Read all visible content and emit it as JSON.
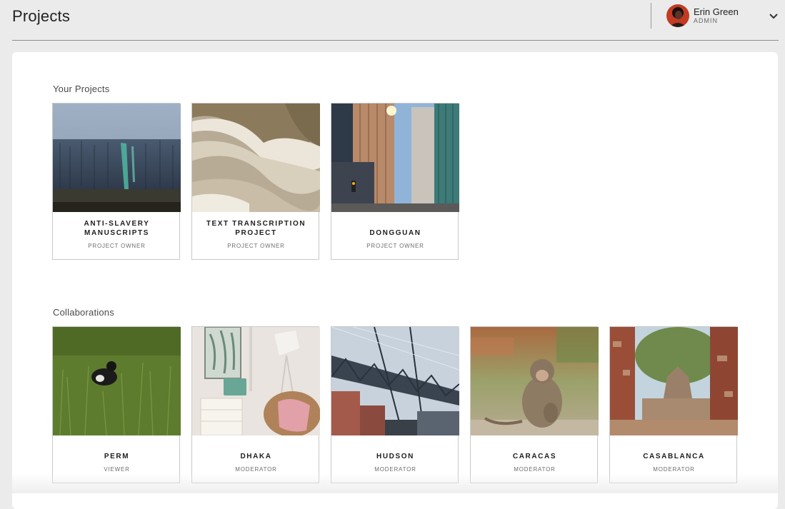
{
  "header": {
    "title": "Projects",
    "user": {
      "name": "Erin Green",
      "role": "ADMIN"
    }
  },
  "sections": {
    "your_projects": {
      "title": "Your Projects",
      "cards": [
        {
          "name": "ANTI-SLAVERY MANUSCRIPTS",
          "role": "PROJECT OWNER",
          "image": "weathered-wall-photo"
        },
        {
          "name": "TEXT TRANSCRIPTION PROJECT",
          "role": "PROJECT OWNER",
          "image": "desert-dunes-photo"
        },
        {
          "name": "DONGGUAN",
          "role": "PROJECT OWNER",
          "image": "city-skyscrapers-photo"
        }
      ]
    },
    "collaborations": {
      "title": "Collaborations",
      "cards": [
        {
          "name": "PERM",
          "role": "VIEWER",
          "image": "bird-in-grass-photo"
        },
        {
          "name": "DHAKA",
          "role": "MODERATOR",
          "image": "vintage-room-photo"
        },
        {
          "name": "HUDSON",
          "role": "MODERATOR",
          "image": "bridge-photo"
        },
        {
          "name": "CARACAS",
          "role": "MODERATOR",
          "image": "monkey-photo"
        },
        {
          "name": "CASABLANCA",
          "role": "MODERATOR",
          "image": "ruins-photo"
        }
      ]
    }
  },
  "colors": {
    "background": "#ebebeb",
    "panel": "#ffffff",
    "card_border": "#c9c9c9"
  }
}
